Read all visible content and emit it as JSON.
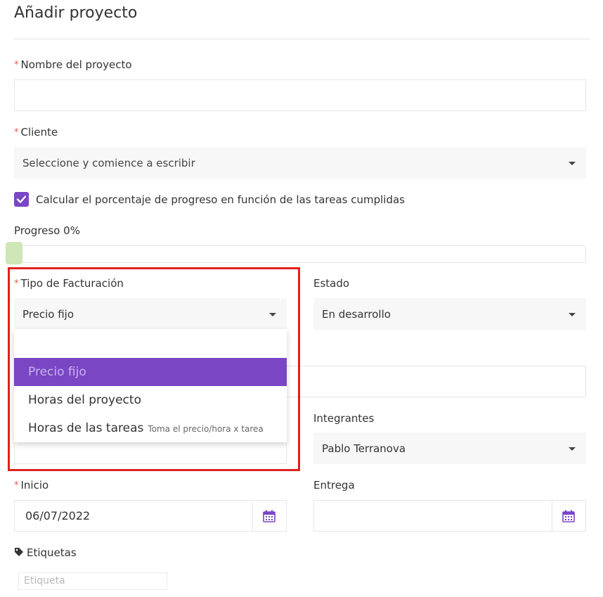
{
  "page": {
    "title": "Añadir proyecto"
  },
  "form": {
    "required_mark": "*",
    "project_name": {
      "label": "Nombre del proyecto",
      "value": ""
    },
    "client": {
      "label": "Cliente",
      "placeholder": "Seleccione y comience a escribir"
    },
    "progress_checkbox": {
      "label": "Calcular el porcentaje de progreso en función de las tareas cumplidas",
      "checked": true
    },
    "progress": {
      "label": "Progreso 0%",
      "value": 0
    },
    "billing_type": {
      "label": "Tipo de Facturación",
      "value": "Precio fijo",
      "search_value": "",
      "options": [
        {
          "label": "Precio fijo",
          "hint": "",
          "selected": true
        },
        {
          "label": "Horas del proyecto",
          "hint": "",
          "selected": false
        },
        {
          "label": "Horas de las tareas",
          "hint": "Toma el precio/hora x tarea",
          "selected": false
        }
      ]
    },
    "status": {
      "label": "Estado",
      "value": "En desarrollo"
    },
    "members": {
      "label": "Integrantes",
      "value": "Pablo Terranova"
    },
    "start": {
      "label": "Inicio",
      "value": "06/07/2022"
    },
    "delivery": {
      "label": "Entrega",
      "value": ""
    },
    "tags": {
      "label": "Etiquetas",
      "placeholder": "Etiqueta"
    }
  },
  "colors": {
    "accent": "#7a46c4",
    "highlight_border": "#e0201e",
    "required": "#e05656",
    "progress_knob": "#cfe6b6"
  },
  "icons": [
    "check-icon",
    "caret-down-icon",
    "calendar-icon",
    "tag-icon"
  ]
}
